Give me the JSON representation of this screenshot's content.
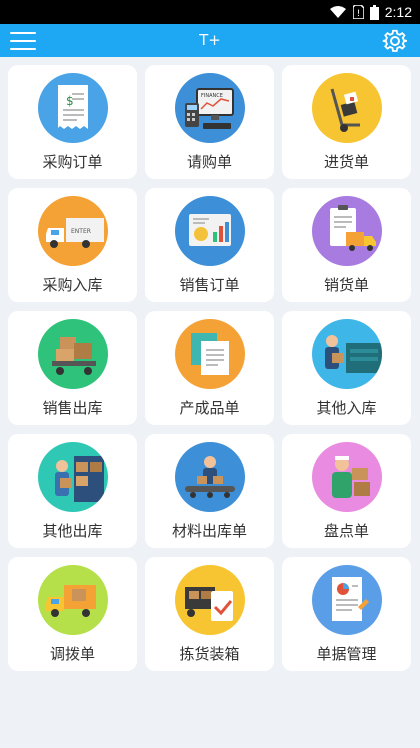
{
  "status_bar": {
    "time": "2:12"
  },
  "app_bar": {
    "title": "T+"
  },
  "tiles": [
    {
      "label": "采购订单",
      "icon": "receipt-icon",
      "color": "#4aa3e6"
    },
    {
      "label": "请购单",
      "icon": "finance-computer-icon",
      "color": "#3d8fd8"
    },
    {
      "label": "进货单",
      "icon": "hand-truck-icon",
      "color": "#f7c531"
    },
    {
      "label": "采购入库",
      "icon": "delivery-truck-icon",
      "color": "#f4a235"
    },
    {
      "label": "销售订单",
      "icon": "sales-chart-icon",
      "color": "#3d8fd8"
    },
    {
      "label": "销货单",
      "icon": "clipboard-truck-icon",
      "color": "#a77be0"
    },
    {
      "label": "销售出库",
      "icon": "cart-boxes-icon",
      "color": "#2fc27a"
    },
    {
      "label": "产成品单",
      "icon": "documents-icon",
      "color": "#f4a235"
    },
    {
      "label": "其他入库",
      "icon": "worker-truck-icon",
      "color": "#3fb6e8"
    },
    {
      "label": "其他出库",
      "icon": "worker-boxes-icon",
      "color": "#2fc8b5"
    },
    {
      "label": "材料出库单",
      "icon": "conveyor-icon",
      "color": "#3d8fd8"
    },
    {
      "label": "盘点单",
      "icon": "inventory-worker-icon",
      "color": "#e98be0"
    },
    {
      "label": "调拨单",
      "icon": "dump-truck-icon",
      "color": "#b5e04a"
    },
    {
      "label": "拣货装箱",
      "icon": "packing-check-icon",
      "color": "#f7c531"
    },
    {
      "label": "单据管理",
      "icon": "document-report-icon",
      "color": "#5b9ee8"
    }
  ]
}
